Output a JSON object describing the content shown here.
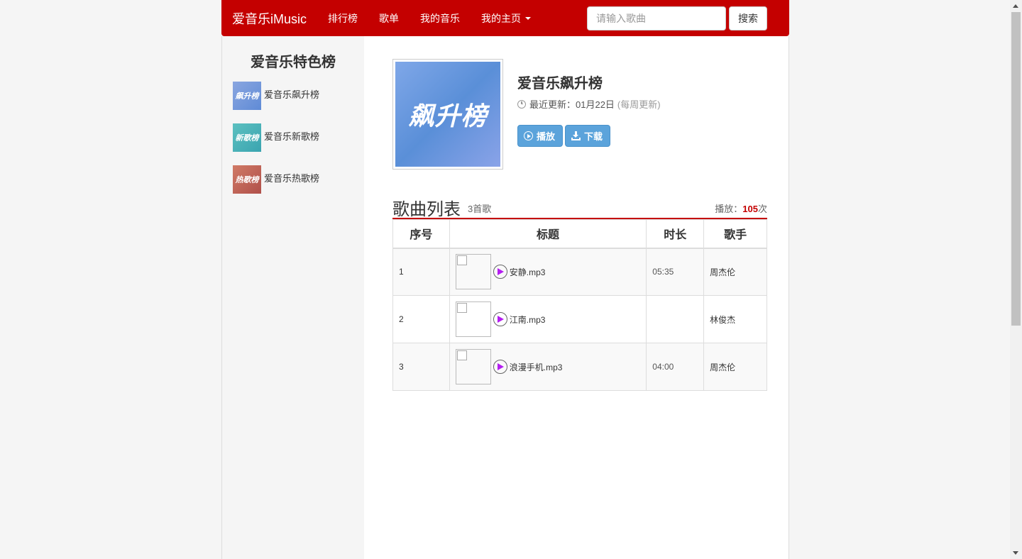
{
  "navbar": {
    "brand": "爱音乐iMusic",
    "links": [
      "排行榜",
      "歌单",
      "我的音乐",
      "我的主页"
    ],
    "search_placeholder": "请输入歌曲",
    "search_button": "搜索"
  },
  "sidebar": {
    "title": "爱音乐特色榜",
    "items": [
      {
        "label": "爱音乐飙升榜",
        "thumb_text": "飙升榜",
        "color": "#6a8fd8"
      },
      {
        "label": "爱音乐新歌榜",
        "thumb_text": "新歌榜",
        "color": "#4bb3b8"
      },
      {
        "label": "爱音乐热歌榜",
        "thumb_text": "热歌榜",
        "color": "#c0605a"
      }
    ]
  },
  "chart": {
    "cover_text": "飙升榜",
    "title": "爱音乐飙升榜",
    "update_label": "最近更新：01月22日",
    "update_note": "(每周更新)",
    "play_button": "播放",
    "download_button": "下载"
  },
  "song_list": {
    "title": "歌曲列表",
    "count": "3首歌",
    "plays_label": "播放：",
    "plays_value": "105",
    "plays_suffix": "次",
    "headers": [
      "序号",
      "标题",
      "时长",
      "歌手"
    ],
    "rows": [
      {
        "index": "1",
        "title": "安静.mp3",
        "duration": "05:35",
        "artist": "周杰伦"
      },
      {
        "index": "2",
        "title": "江南.mp3",
        "duration": "",
        "artist": "林俊杰"
      },
      {
        "index": "3",
        "title": "浪漫手机.mp3",
        "duration": "04:00",
        "artist": "周杰伦"
      }
    ]
  },
  "colors": {
    "brand_red": "#c40000",
    "button_blue": "#5ba3db",
    "play_purple": "#b41ef0"
  }
}
